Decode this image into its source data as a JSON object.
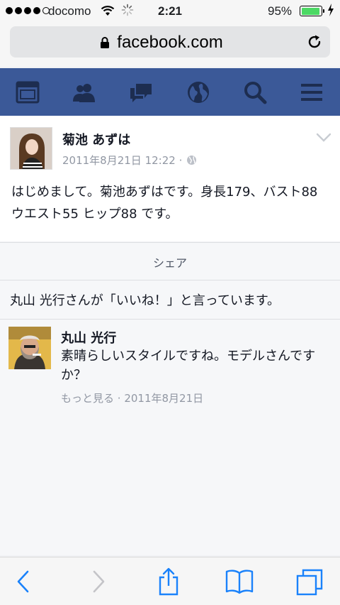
{
  "status_bar": {
    "carrier": "docomo",
    "time": "2:21",
    "battery_percent": "95%",
    "battery_level": 0.95
  },
  "browser": {
    "url": "facebook.com"
  },
  "nav": {
    "icons": [
      "news-feed-icon",
      "friends-icon",
      "messages-icon",
      "notifications-globe-icon",
      "search-icon",
      "menu-icon"
    ],
    "bg_color": "#3b5998"
  },
  "post": {
    "author": "菊池 あずは",
    "date": "2011年8月21日 12:22 ·",
    "text": "はじめまして。菊池あずはです。身長179、バスト88 ウエスト55 ヒップ88 です。"
  },
  "share": {
    "label": "シェア"
  },
  "likes": {
    "text": "丸山 光行さんが「いいね！」と言っています。"
  },
  "comment": {
    "author": "丸山 光行",
    "text": "素晴らしいスタイルですね。モデルさんですか？",
    "more_label": "もっと見る",
    "date": " · 2011年8月21日"
  },
  "toolbar": {
    "icons": [
      "back-icon",
      "forward-icon",
      "share-icon",
      "bookmarks-icon",
      "tabs-icon"
    ],
    "accent": "#1a82fb"
  }
}
